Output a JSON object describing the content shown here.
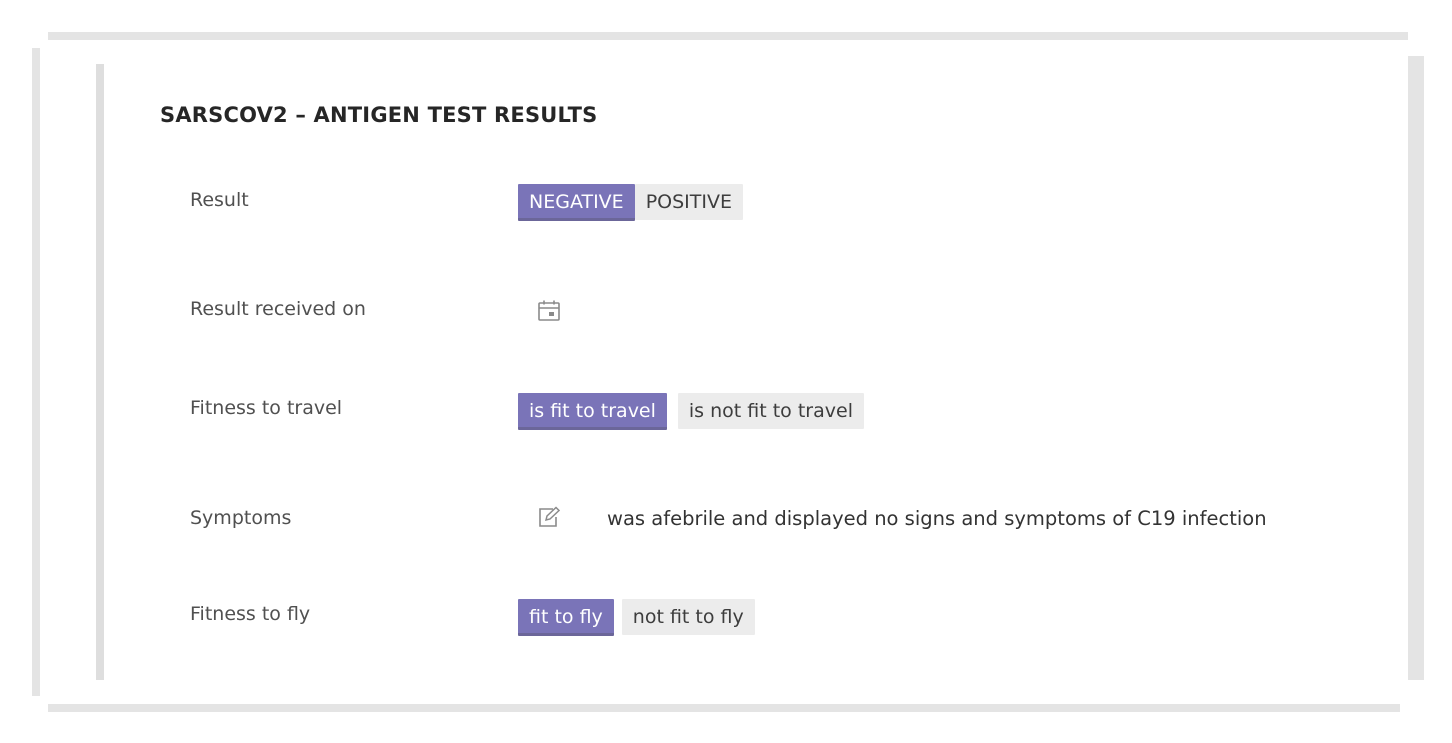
{
  "panel": {
    "title": "SARSCOV2 – ANTIGEN TEST RESULTS"
  },
  "rows": {
    "result": {
      "label": "Result",
      "options": [
        "NEGATIVE",
        "POSITIVE"
      ],
      "selected": "NEGATIVE"
    },
    "received_on": {
      "label": "Result received on",
      "icon": "calendar-icon"
    },
    "fitness_travel": {
      "label": "Fitness to travel",
      "options": [
        "is fit to travel",
        "is not fit to travel"
      ],
      "selected": "is fit to travel"
    },
    "symptoms": {
      "label": "Symptoms",
      "icon": "edit-icon",
      "value": "was afebrile and displayed no signs and symptoms of C19 infection"
    },
    "fitness_fly": {
      "label": "Fitness to fly",
      "options": [
        "fit to fly",
        "not fit to fly"
      ],
      "selected": "fit to fly"
    }
  },
  "colors": {
    "selected": "#7a74b8",
    "unselected": "#ececec",
    "frame": "#e4e4e4"
  }
}
